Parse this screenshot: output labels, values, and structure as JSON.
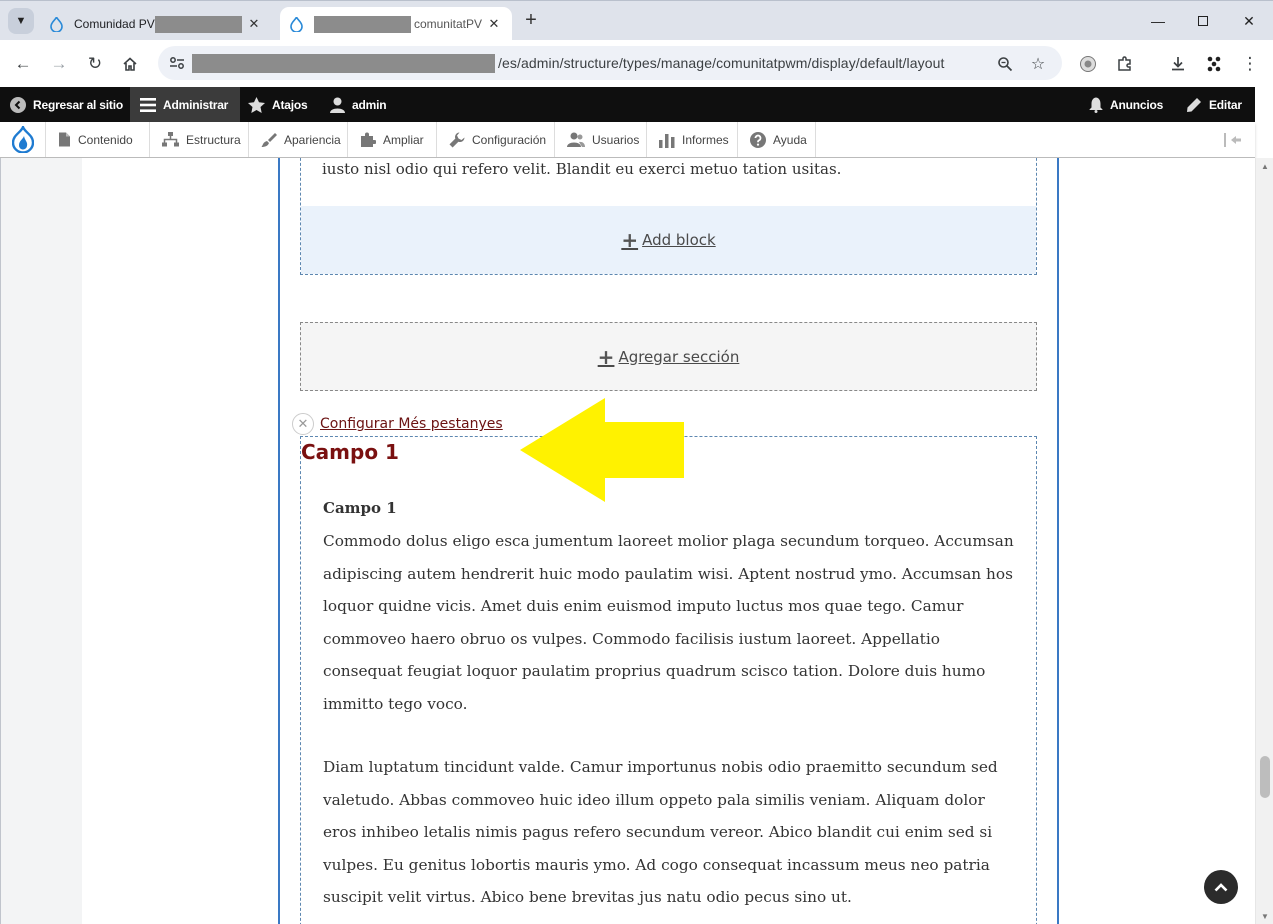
{
  "browser": {
    "tabs": [
      {
        "title": "Comunidad PV",
        "active": false
      },
      {
        "title": "comunitatPV",
        "active": true
      }
    ],
    "url": "/es/admin/structure/types/manage/comunitatpwm/display/default/layout"
  },
  "admin_toolbar": {
    "back_to_site": "Regresar al sitio",
    "manage": "Administrar",
    "shortcuts": "Atajos",
    "user": "admin",
    "announcements": "Anuncios",
    "edit": "Editar"
  },
  "tray": {
    "items": [
      {
        "label": "Contenido",
        "icon": "file-icon"
      },
      {
        "label": "Estructura",
        "icon": "sitemap-icon"
      },
      {
        "label": "Apariencia",
        "icon": "paintbrush-icon"
      },
      {
        "label": "Ampliar",
        "icon": "puzzle-icon"
      },
      {
        "label": "Configuración",
        "icon": "wrench-icon"
      },
      {
        "label": "Usuarios",
        "icon": "people-icon"
      },
      {
        "label": "Informes",
        "icon": "bar-chart-icon"
      },
      {
        "label": "Ayuda",
        "icon": "help-icon"
      }
    ]
  },
  "layout_builder": {
    "top_text": "iusto nisl odio qui refero velit. Blandit eu exerci metuo tation usitas.",
    "add_block": "Add block",
    "add_section": "Agregar sección",
    "configure_link": "Configurar Més pestanyes",
    "section_title": "Campo 1",
    "field_label": "Campo 1",
    "paragraph_1": "Commodo dolus eligo esca jumentum laoreet molior plaga secundum torqueo. Accumsan adipiscing autem hendrerit huic modo paulatim wisi. Aptent nostrud ymo. Accumsan hos loquor quidne vicis. Amet duis enim euismod imputo luctus mos quae tego. Camur commoveo haero obruo os vulpes. Commodo facilisis iustum laoreet. Appellatio consequat feugiat loquor paulatim proprius quadrum scisco tation. Dolore duis humo immitto tego voco.",
    "paragraph_2": "Diam luptatum tincidunt valde. Camur importunus nobis odio praemitto secundum sed valetudo. Abbas commoveo huic ideo illum oppeto pala similis veniam. Aliquam dolor eros inhibeo letalis nimis pagus refero secundum vereor. Abico blandit cui enim sed si vulpes. Eu genitus lobortis mauris ymo. Ad cogo consequat incassum meus neo patria suscipit velit virtus. Abico bene brevitas jus natu odio pecus sino ut."
  },
  "colors": {
    "accent_blue": "#3a79c4",
    "section_title": "#7a1010",
    "annotation_arrow": "#fff200"
  }
}
